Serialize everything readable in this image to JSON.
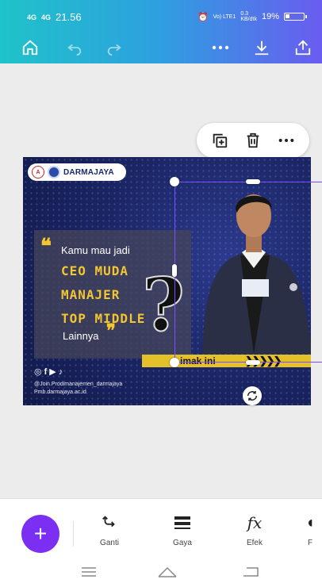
{
  "status_bar": {
    "signal1": "4G",
    "signal2": "4G",
    "time": "21.56",
    "network_speed": "0.3",
    "network_unit": "KB/dtk",
    "lte": "Vo) LTE1",
    "battery": "19%"
  },
  "toolbar": {
    "home_icon": "home-icon",
    "undo_icon": "undo-icon",
    "redo_icon": "redo-icon",
    "more_icon": "more-horizontal-icon",
    "download_icon": "download-icon",
    "share_icon": "upload-icon"
  },
  "floating_actions": {
    "duplicate_icon": "duplicate-icon",
    "delete_icon": "trash-icon",
    "more_icon": "more-horizontal-icon"
  },
  "design": {
    "logo_text": "DARMAJAYA",
    "line1": "Kamu mau jadi",
    "line2": "CEO MUDA",
    "line3": "MANAJER",
    "line4": "TOP MIDDLE",
    "line5": "Lainnya",
    "band_text": "imak ini",
    "handle1": "@Join.Prodimanajemen_darmajaya",
    "handle2": "Pmb.darmajaya.ac.id"
  },
  "bottom_toolbar": {
    "add_label": "+",
    "tools": [
      {
        "label": "Ganti",
        "icon": "replace-icon"
      },
      {
        "label": "Gaya",
        "icon": "style-icon"
      },
      {
        "label": "Efek",
        "icon": "effects-icon"
      },
      {
        "label": "F",
        "icon": "filter-icon"
      }
    ]
  },
  "colors": {
    "accent": "#7b2ff2",
    "selection": "#7c4dff",
    "header_start": "#1fc3c9",
    "header_end": "#6a5cf0",
    "design_yellow": "#f2c531",
    "design_navy": "#1b2563"
  }
}
